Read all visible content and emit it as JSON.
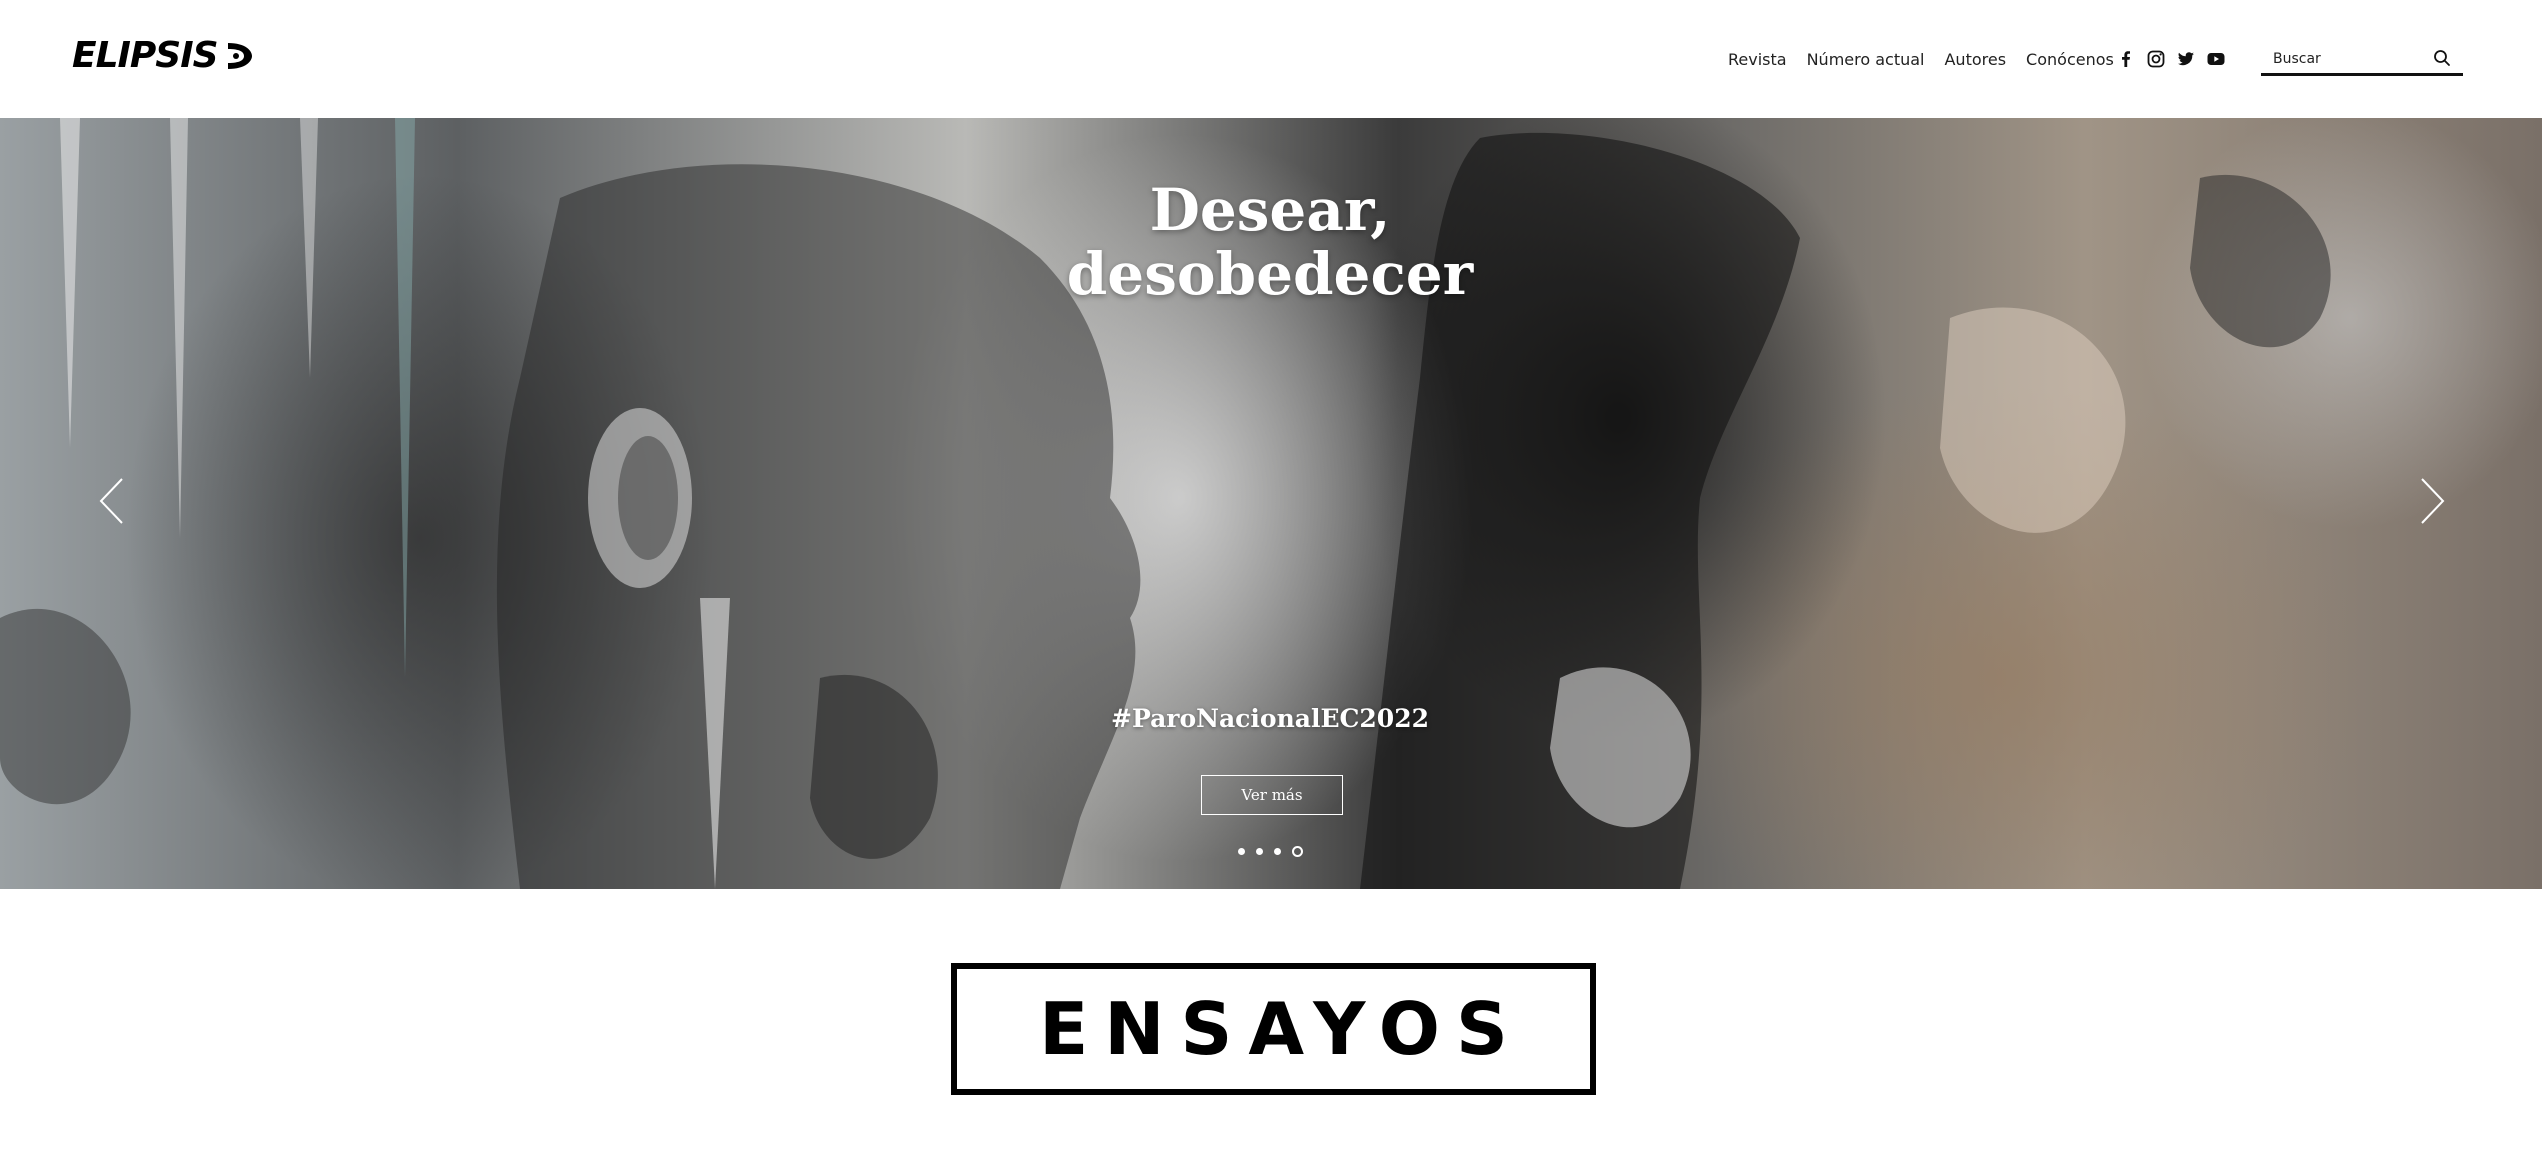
{
  "header": {
    "logo_text": "ELIPSIS",
    "nav": [
      {
        "label": "Revista"
      },
      {
        "label": "Número actual"
      },
      {
        "label": "Autores"
      },
      {
        "label": "Conócenos"
      }
    ],
    "social_icons": [
      "facebook-icon",
      "instagram-icon",
      "twitter-icon",
      "youtube-icon"
    ],
    "search": {
      "placeholder": "Buscar"
    }
  },
  "hero": {
    "title": "Desear,\ndesobedecer",
    "tag": "#ParoNacionalEC2022",
    "button_label": "Ver más",
    "slides_count": 4,
    "active_slide": 4
  },
  "section": {
    "heading": "ENSAYOS"
  },
  "colors": {
    "text": "#000000",
    "background": "#ffffff",
    "hero_text": "#ffffff"
  }
}
